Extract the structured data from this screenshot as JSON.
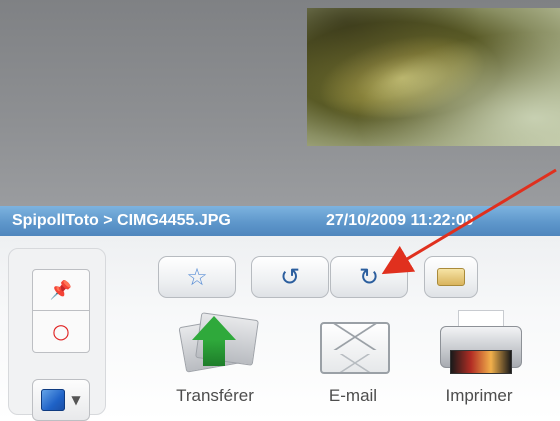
{
  "status": {
    "path": "SpipollToto > CIMG4455.JPG",
    "datetime": "27/10/2009 11:22:00"
  },
  "left_panel": {
    "pin_icon": "green-pin-icon",
    "circle_icon": "red-circle-icon",
    "album_icon": "blue-album-icon"
  },
  "toolbar_buttons": [
    {
      "name": "favorite",
      "icon": "star-icon"
    },
    {
      "name": "rotate-left",
      "icon": "rotate-left-icon"
    },
    {
      "name": "rotate-right",
      "icon": "rotate-right-icon"
    },
    {
      "name": "tag",
      "icon": "tag-icon"
    }
  ],
  "actions": {
    "transfer_label": "Transférer",
    "email_label": "E-mail",
    "print_label": "Imprimer"
  },
  "colors": {
    "status_bar": "#5e97cb",
    "annotation_arrow": "#e0301e"
  }
}
